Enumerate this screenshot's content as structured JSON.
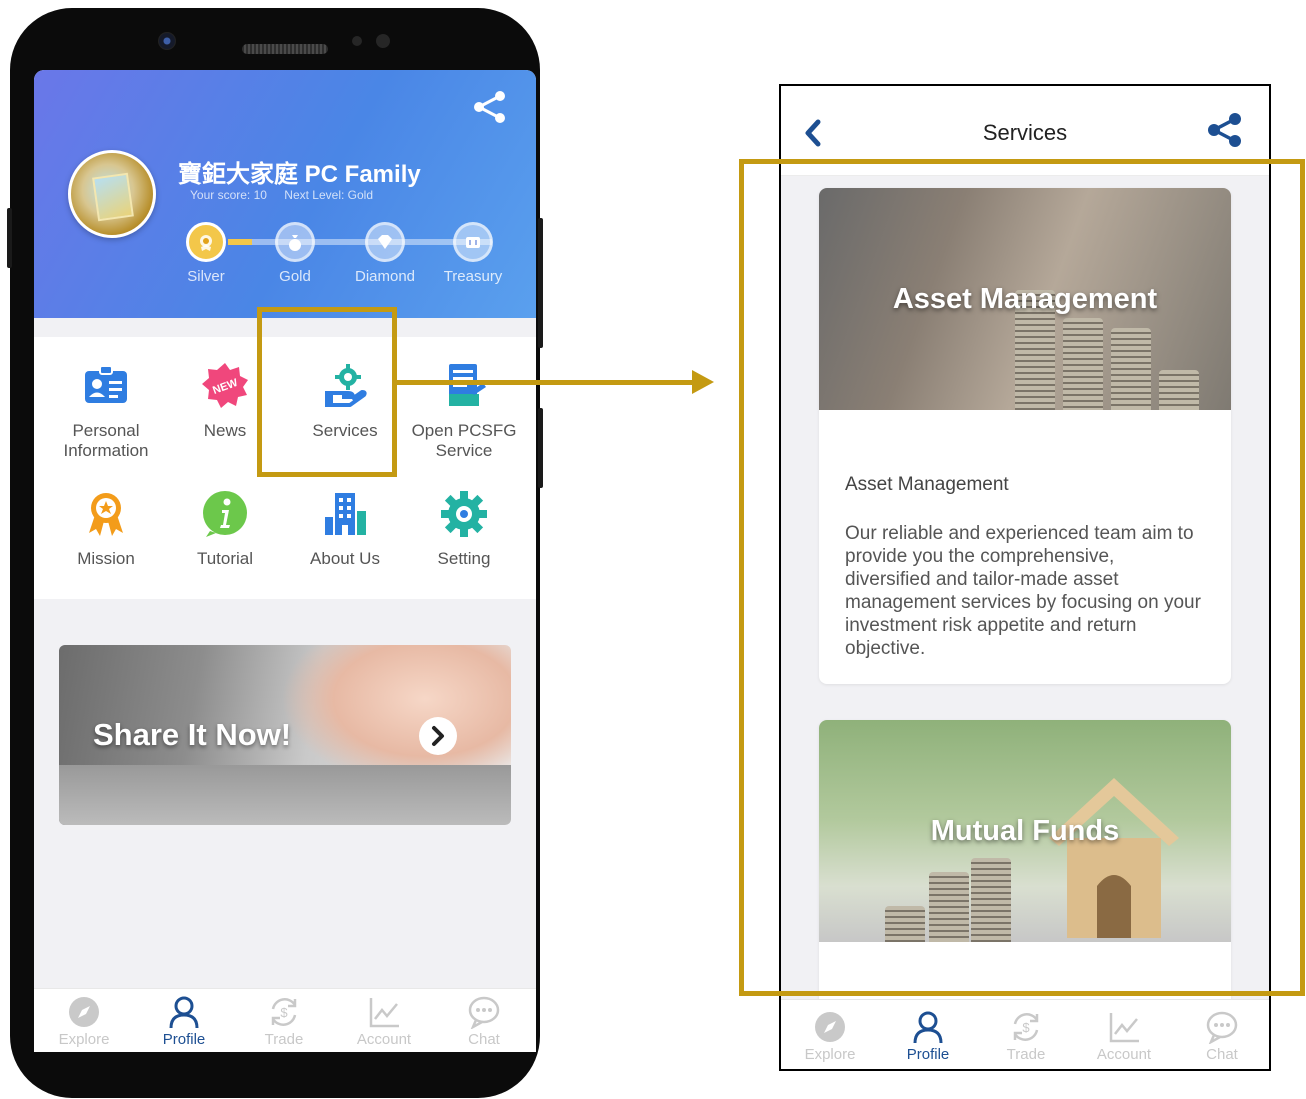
{
  "phone": {
    "profile": {
      "title": "寶鉅大家庭 PC Family",
      "score": "Your score: 10",
      "next_level": "Next Level: Gold"
    },
    "levels": [
      {
        "label": "Silver",
        "icon": "silver-medal-icon"
      },
      {
        "label": "Gold",
        "icon": "gold-bag-icon"
      },
      {
        "label": "Diamond",
        "icon": "diamond-icon"
      },
      {
        "label": "Treasury",
        "icon": "treasury-icon"
      }
    ],
    "current_level": "Silver",
    "menu": [
      {
        "label": "Personal Information",
        "icon": "id-card-icon"
      },
      {
        "label": "News",
        "icon": "news-badge-icon"
      },
      {
        "label": "Services",
        "icon": "services-hand-gear-icon"
      },
      {
        "label": "Open PCSFG Service",
        "icon": "document-form-icon"
      },
      {
        "label": "Mission",
        "icon": "ribbon-medal-icon"
      },
      {
        "label": "Tutorial",
        "icon": "info-icon"
      },
      {
        "label": "About Us",
        "icon": "building-icon"
      },
      {
        "label": "Setting",
        "icon": "gear-icon"
      }
    ],
    "news_badge": "NEW",
    "banner": {
      "title": "Share It Now!"
    }
  },
  "tabs": [
    {
      "label": "Explore",
      "icon": "compass-icon"
    },
    {
      "label": "Profile",
      "icon": "person-icon"
    },
    {
      "label": "Trade",
      "icon": "dollar-exchange-icon"
    },
    {
      "label": "Account",
      "icon": "line-chart-icon"
    },
    {
      "label": "Chat",
      "icon": "chat-bubble-icon"
    }
  ],
  "active_tab": "Profile",
  "services_panel": {
    "title": "Services",
    "cards": [
      {
        "image_title": "Asset Management",
        "heading": "Asset Management",
        "description": "Our reliable and experienced team aim to provide you the comprehensive, diversified and tailor-made asset management services by focusing on your investment risk appetite and return objective."
      },
      {
        "image_title": "Mutual Funds"
      }
    ]
  },
  "colors": {
    "highlight": "#c49a12",
    "brand_blue": "#1d4f92",
    "hero_start": "#6a77e8",
    "hero_end": "#5aa0ee",
    "level_active": "#f3c74a"
  }
}
